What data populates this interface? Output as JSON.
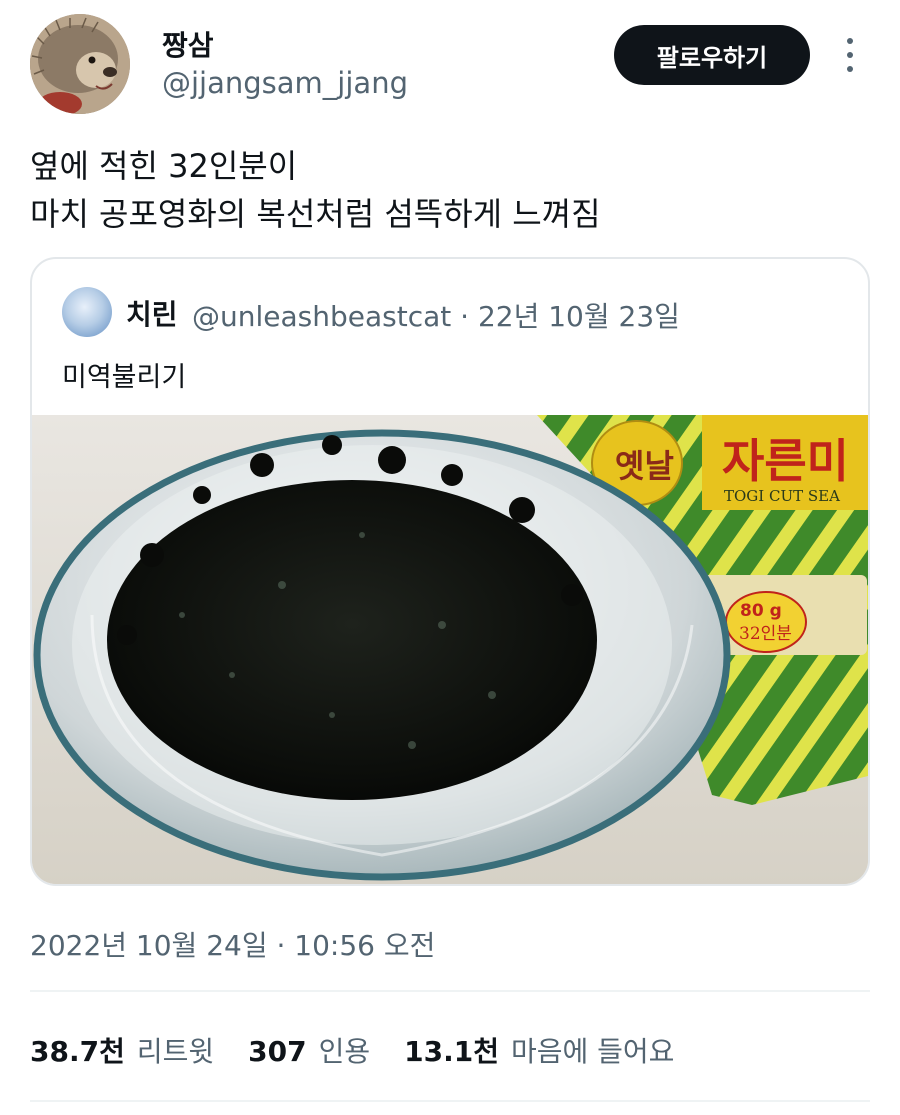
{
  "author": {
    "display_name": "짱삼",
    "handle": "@jjangsam_jjang"
  },
  "actions": {
    "follow_label": "팔로우하기"
  },
  "tweet": {
    "lines": [
      "옆에 적힌 32인분이",
      "마치 공포영화의 복선처럼 섬뜩하게 느껴짐"
    ],
    "timestamp": "2022년 10월 24일 · 10:56 오전"
  },
  "quote": {
    "display_name": "치린",
    "meta": "@unleashbeastcat · 22년 10월 23일",
    "text": "미역불리기",
    "image": {
      "package_label": "자른미",
      "package_subtext": "TOGI CUT SEA",
      "package_weight": "80 g",
      "package_servings": "32인분",
      "package_brand": "옛날"
    }
  },
  "stats": [
    {
      "value": "38.7천",
      "label": "리트윗"
    },
    {
      "value": "307",
      "label": "인용"
    },
    {
      "value": "13.1천",
      "label": "마음에 들어요"
    }
  ],
  "colors": {
    "primary_text": "#0f1419",
    "secondary_text": "#536471",
    "follow_bg": "#0f1419",
    "border": "#e3e7ea"
  }
}
